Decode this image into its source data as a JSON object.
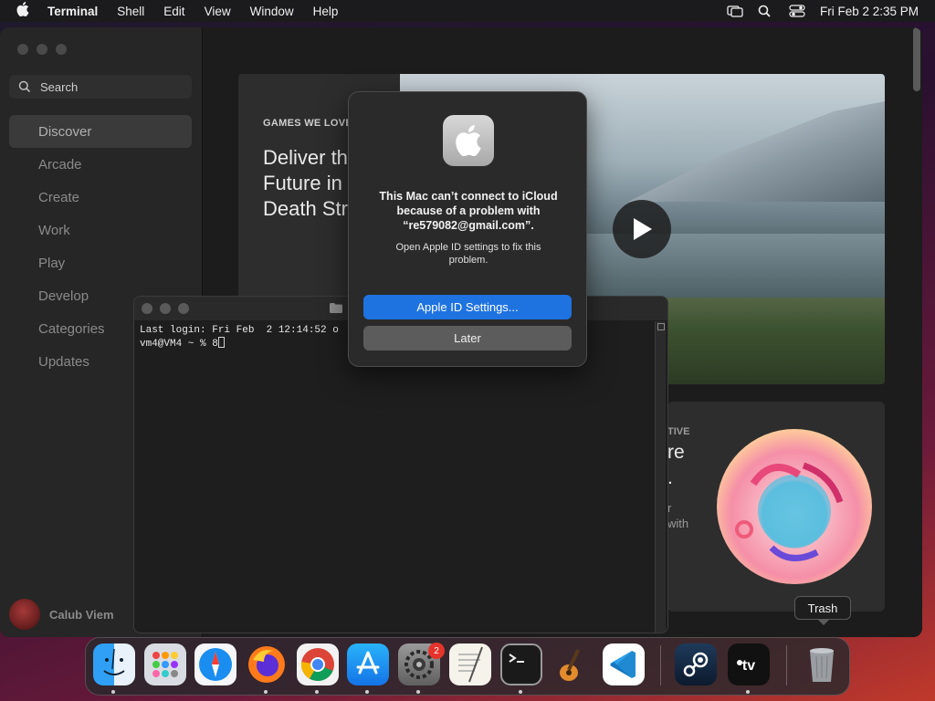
{
  "menubar": {
    "app_name": "Terminal",
    "menus": [
      "Shell",
      "Edit",
      "View",
      "Window",
      "Help"
    ],
    "clock": "Fri Feb 2  2:35 PM"
  },
  "appstore": {
    "search_placeholder": "Search",
    "nav": [
      "Discover",
      "Arcade",
      "Create",
      "Work",
      "Play",
      "Develop",
      "Categories",
      "Updates"
    ],
    "active_nav": "Discover",
    "user_name": "Calub Viem",
    "hero": {
      "eyebrow": "GAMES WE LOVE",
      "title_lines": [
        "Deliver th",
        "Future in",
        "Death Str"
      ]
    },
    "card2": {
      "eyebrow": "TIVE",
      "big_lines": [
        "re",
        "."
      ],
      "small_lines": [
        "r",
        "with"
      ]
    }
  },
  "terminal": {
    "line1": "Last login: Fri Feb  2 12:14:52 o",
    "line2": "vm4@VM4 ~ % 8"
  },
  "dialog": {
    "title": "This Mac can’t connect to iCloud because of a problem with “re579082@gmail.com”.",
    "message": "Open Apple ID settings to fix this problem.",
    "primary_button": "Apple ID Settings...",
    "secondary_button": "Later"
  },
  "dock": {
    "apps": [
      "finder",
      "launchpad",
      "safari",
      "firefox",
      "chrome",
      "app-store",
      "system-settings",
      "textedit",
      "terminal",
      "garageband",
      "vscode",
      "steam",
      "apple-tv",
      "trash"
    ],
    "settings_badge": "2",
    "tooltip": "Trash"
  },
  "colors": {
    "accent": "#1f73e0",
    "badge": "#e5342b"
  }
}
